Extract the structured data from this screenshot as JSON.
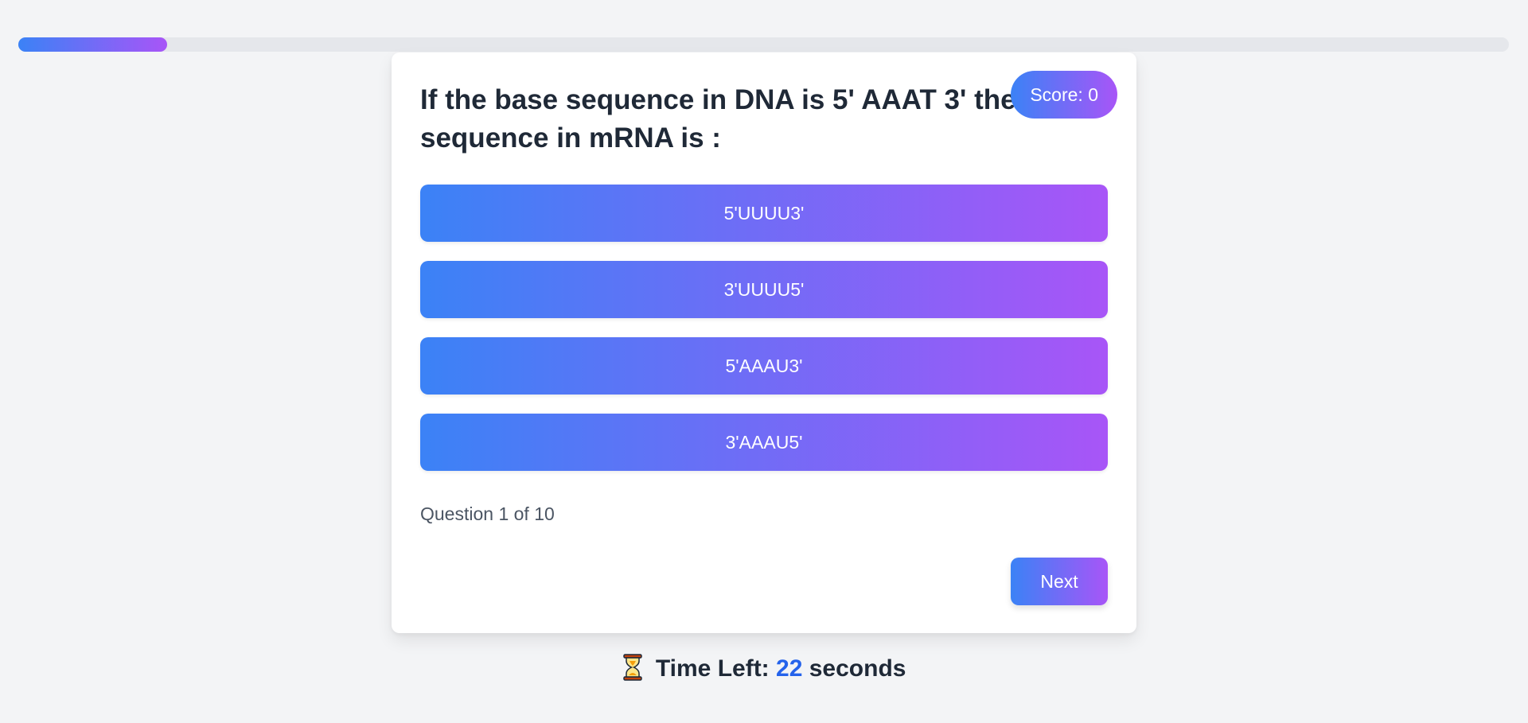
{
  "progress": {
    "fraction": 0.1
  },
  "quiz": {
    "score_label": "Score: 0",
    "question": "If the base sequence in DNA is 5' AAAT 3' then base sequence in mRNA is :",
    "options": [
      "5'UUUU3'",
      "3'UUUU5'",
      "5'AAAU3'",
      "3'AAAU5'"
    ],
    "counter": "Question 1 of 10",
    "next_label": "Next"
  },
  "timer": {
    "icon": "hourglass-icon",
    "prefix": "Time Left:",
    "value": "22",
    "suffix": "seconds"
  },
  "colors": {
    "gradient_start": "#3b82f6",
    "gradient_end": "#a855f7",
    "timer_value": "#2563eb",
    "background": "#f3f4f6"
  }
}
